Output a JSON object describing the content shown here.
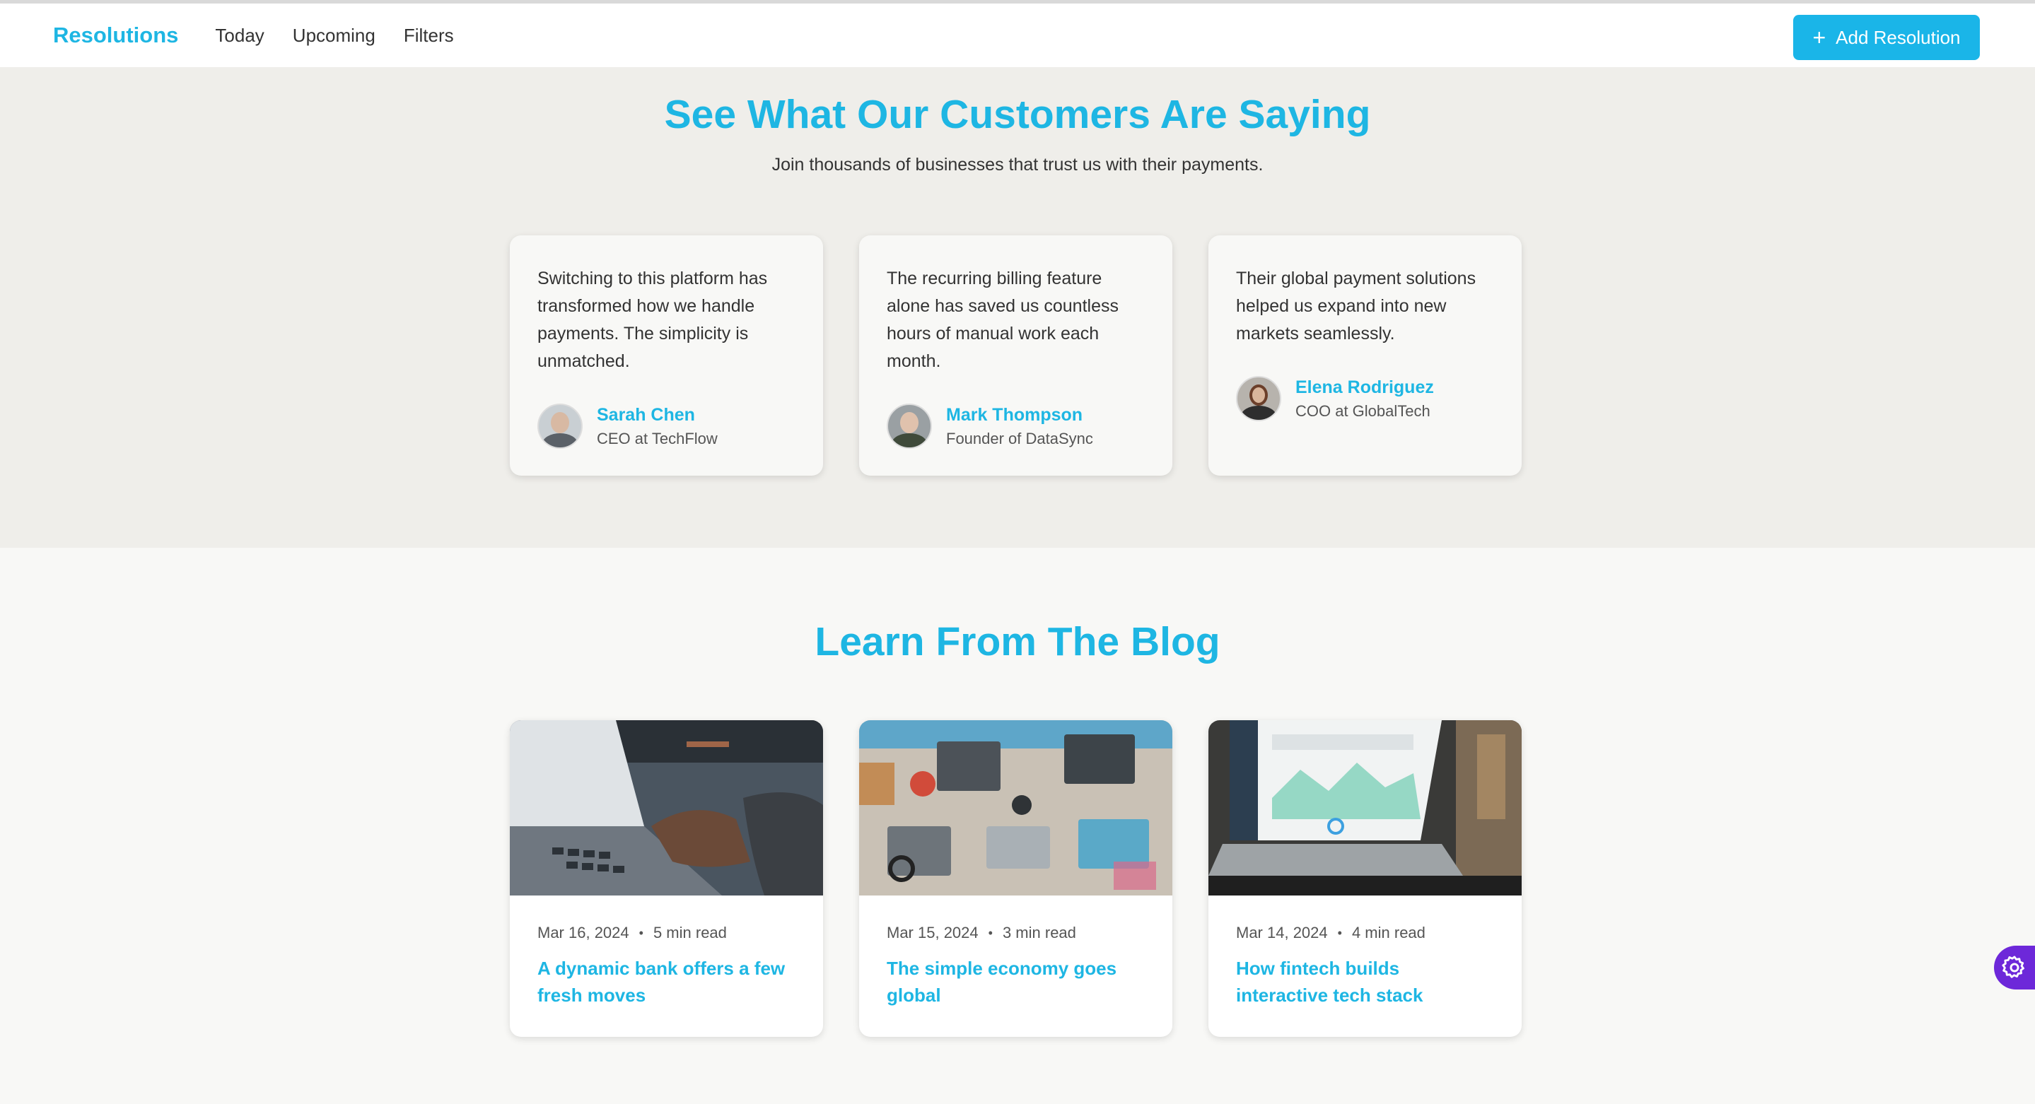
{
  "nav": {
    "brand": "Resolutions",
    "links": [
      "Today",
      "Upcoming",
      "Filters"
    ],
    "add_button": "Add Resolution"
  },
  "testimonials": {
    "title": "See What Our Customers Are Saying",
    "subtitle": "Join thousands of businesses that trust us with their payments.",
    "cards": [
      {
        "quote": "Switching to this platform has transformed how we handle payments. The simplicity is unmatched.",
        "name": "Sarah Chen",
        "role": "CEO at TechFlow"
      },
      {
        "quote": "The recurring billing feature alone has saved us countless hours of manual work each month.",
        "name": "Mark Thompson",
        "role": "Founder of DataSync"
      },
      {
        "quote": "Their global payment solutions helped us expand into new markets seamlessly.",
        "name": "Elena Rodriguez",
        "role": "COO at GlobalTech"
      }
    ]
  },
  "blog": {
    "title": "Learn From The Blog",
    "posts": [
      {
        "date": "Mar 16, 2024",
        "read": "5 min read",
        "title": "A dynamic bank offers a few fresh moves"
      },
      {
        "date": "Mar 15, 2024",
        "read": "3 min read",
        "title": "The simple economy goes global"
      },
      {
        "date": "Mar 14, 2024",
        "read": "4 min read",
        "title": "How fintech builds interactive tech stack"
      }
    ]
  },
  "colors": {
    "accent": "#1eb6e3",
    "button": "#1ab5e8",
    "fab": "#6d28d9"
  }
}
